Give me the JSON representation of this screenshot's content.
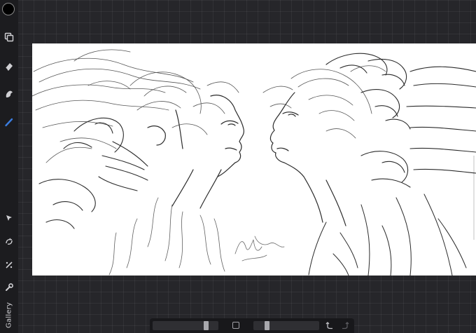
{
  "sidebar": {
    "color_swatch": "#000000",
    "tools_top": [
      "layers-icon",
      "eraser-icon",
      "smudge-icon",
      "brush-icon"
    ],
    "tools_bottom": [
      "selection-icon",
      "transform-icon",
      "adjustments-icon",
      "actions-icon"
    ],
    "gallery_label": "Gallery",
    "accent": "#3b7de0"
  },
  "canvas": {
    "background": "#ffffff",
    "ink": "#2b2b2b"
  },
  "bottom_bar": {
    "brush_size": 0.84,
    "opacity": 0.18,
    "undo_icon": "undo-icon",
    "redo_icon": "redo-icon",
    "redo_disabled": true
  }
}
